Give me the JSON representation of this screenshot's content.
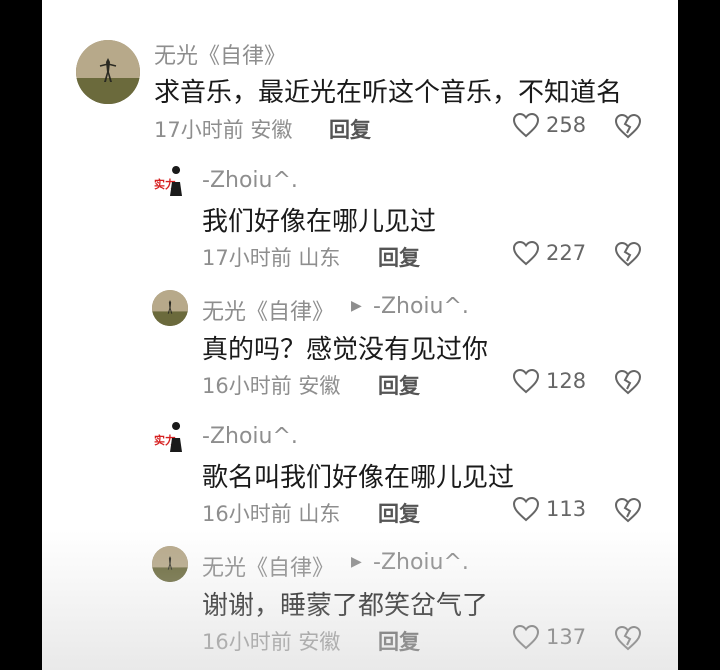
{
  "comments": [
    {
      "user": "无光《自律》",
      "text": "求音乐，最近光在听这个音乐，不知道名",
      "time_location": "17小时前 安徽",
      "reply_label": "回复",
      "likes": "258"
    },
    {
      "user": "-Zhoiu^.",
      "text": "我们好像在哪儿见过",
      "time_location": "17小时前 山东",
      "reply_label": "回复",
      "likes": "227"
    },
    {
      "user": "无光《自律》",
      "reply_to": "-Zhoiu^.",
      "text": "真的吗？感觉没有见过你",
      "time_location": "16小时前 安徽",
      "reply_label": "回复",
      "likes": "128"
    },
    {
      "user": "-Zhoiu^.",
      "text": "歌名叫我们好像在哪儿见过",
      "time_location": "16小时前 山东",
      "reply_label": "回复",
      "likes": "113"
    },
    {
      "user": "无光《自律》",
      "reply_to": "-Zhoiu^.",
      "text": "谢谢，睡蒙了都笑岔气了",
      "time_location": "16小时前 安徽",
      "reply_label": "回复",
      "likes": "137"
    }
  ],
  "avatar_text": "实力",
  "colors": {
    "meta": "#8e8e8e",
    "text": "#1a1a1a",
    "background": "#ffffff"
  }
}
